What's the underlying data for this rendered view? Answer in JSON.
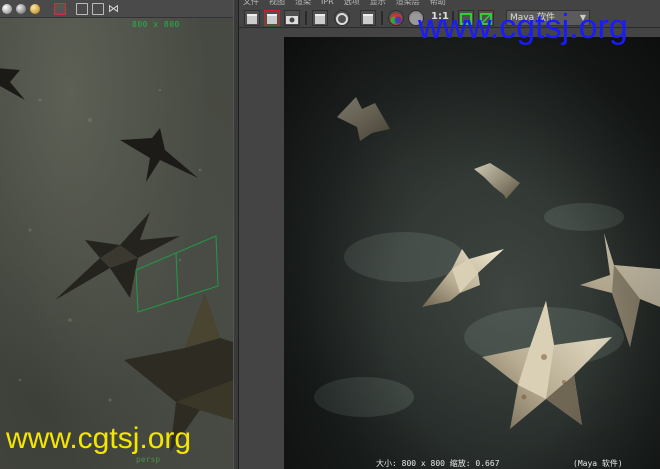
{
  "viewport": {
    "resolution_gate": "800 x 800",
    "toolbar_icons": [
      "shaded-sphere-icon",
      "grey-sphere-icon",
      "gold-sphere-icon",
      "paint-icon",
      "cube-icon",
      "duplicate-icon",
      "share-icon"
    ],
    "bottom_tag": "persp"
  },
  "render_view": {
    "menu": [
      "文件",
      "视图",
      "渲染",
      "IPR",
      "选项",
      "显示",
      "渲染层",
      "帮助"
    ],
    "toolbar": {
      "ratio_label": "1:1",
      "renderer": "Maya 软件"
    },
    "status": {
      "size_text": "大小: 800 x 800 缩放: 0.667",
      "renderer_text": "(Maya 软件)"
    },
    "accent_colors": {
      "active_red": "#cc2222",
      "teal": "#2aa6a6"
    }
  },
  "watermarks": {
    "top": "www.cgtsj.org",
    "bottom": "www.cgtsj.org"
  }
}
